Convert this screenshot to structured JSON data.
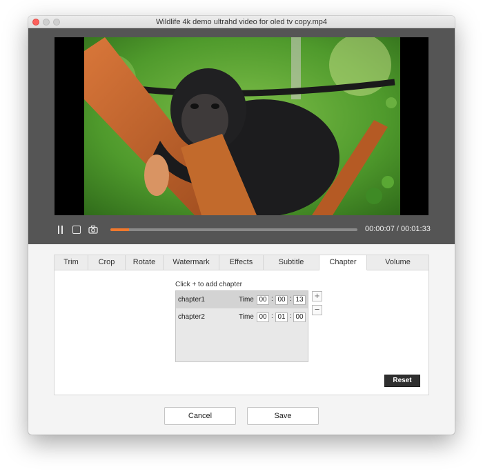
{
  "window": {
    "title": "Wildlife 4k demo ultrahd video for oled tv copy.mp4"
  },
  "player": {
    "current_time": "00:00:07",
    "total_time": "00:01:33",
    "time_display": "00:00:07 / 00:01:33",
    "progress_fraction": 0.075,
    "controls": [
      "pause-icon",
      "stop-icon",
      "camera-icon"
    ]
  },
  "tabs": [
    {
      "label": "Trim"
    },
    {
      "label": "Crop"
    },
    {
      "label": "Rotate"
    },
    {
      "label": "Watermark"
    },
    {
      "label": "Effects"
    },
    {
      "label": "Subtitle"
    },
    {
      "label": "Chapter",
      "active": true
    },
    {
      "label": "Volume"
    }
  ],
  "chapter_panel": {
    "hint": "Click + to add chapter",
    "time_label": "Time",
    "chapters": [
      {
        "name": "chapter1",
        "h": "00",
        "m": "00",
        "s": "13",
        "selected": true
      },
      {
        "name": "chapter2",
        "h": "00",
        "m": "01",
        "s": "00",
        "selected": false
      }
    ],
    "add_label": "+",
    "remove_label": "−",
    "reset_label": "Reset"
  },
  "footer": {
    "cancel_label": "Cancel",
    "save_label": "Save"
  },
  "colors": {
    "accent": "#f0782d",
    "player_bg": "#555555",
    "close_button": "#fc605c"
  }
}
